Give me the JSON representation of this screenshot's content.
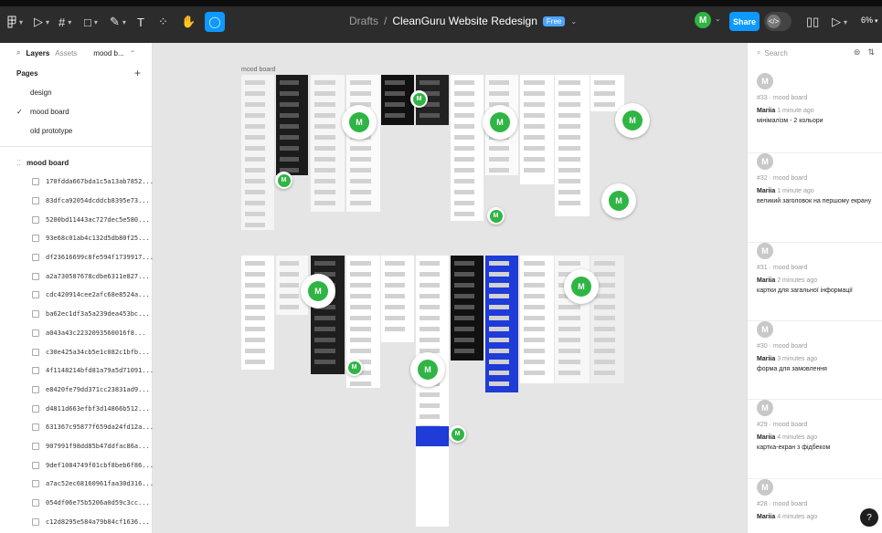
{
  "toolbar": {
    "breadcrumb_root": "Drafts",
    "separator": "/",
    "file_name": "CleanGuru Website Redesign",
    "plan_badge": "Free",
    "avatar_initial": "M",
    "share_label": "Share",
    "zoom_level": "6%"
  },
  "left_panel": {
    "tabs": {
      "layers": "Layers",
      "assets": "Assets",
      "page": "mood b..."
    },
    "pages_heading": "Pages",
    "pages": [
      {
        "label": "design",
        "selected": false
      },
      {
        "label": "mood board",
        "selected": true
      },
      {
        "label": "old prototype",
        "selected": false
      }
    ],
    "frame_name": "mood board",
    "layers": [
      "170fdda667bda1c5a13ab7852...",
      "83dfca92054dcddcb8395e73...",
      "5200bd11443ac727dec5e580...",
      "93e68c01ab4c132d5db80f25...",
      "df23616699c8fe594f1739917...",
      "a2a730587678cdbe6311e827...",
      "cdc420914cee2afc68e8524a...",
      "ba62ec1df3a5a239dea453bc...",
      "a043a43c2232093560016f8...",
      "c30e425a34cb5e1c082c1bfb...",
      "4f1148214bfd81a79a5d71091...",
      "e8420fe79dd371cc23831ad9...",
      "d4811d663efbf3d14866b512...",
      "631367c95877f659da24fd12a...",
      "907991f98dd85b47ddfac86a...",
      "9def1084749f01cbf8beb6f86...",
      "a7ac52ec68160961faa30d316...",
      "054df06e75b5206a0d59c3cc...",
      "c12d8295e584a79b84cf1636..."
    ]
  },
  "canvas": {
    "frame_label": "mood board",
    "pin_initial": "M"
  },
  "right_panel": {
    "search_placeholder": "Search",
    "comments": [
      {
        "avatar": "M",
        "meta": "#33 · mood board",
        "author": "Mariia",
        "time": "1 minute ago",
        "body": "мінімалізм - 2 кольори"
      },
      {
        "avatar": "M",
        "meta": "#32 · mood board",
        "author": "Mariia",
        "time": "1 minute ago",
        "body": "великий заголовок на першому екрану"
      },
      {
        "avatar": "M",
        "meta": "#31 · mood board",
        "author": "Mariia",
        "time": "2 minutes ago",
        "body": "картки для загальної інформації"
      },
      {
        "avatar": "M",
        "meta": "#30 · mood board",
        "author": "Mariia",
        "time": "3 minutes ago",
        "body": "форма для замовлення"
      },
      {
        "avatar": "M",
        "meta": "#29 · mood board",
        "author": "Mariia",
        "time": "4 minutes ago",
        "body": "картка-екран з фідбеком"
      },
      {
        "avatar": "M",
        "meta": "#28 · mood board",
        "author": "Mariia",
        "time": "4 minutes ago",
        "body": ""
      }
    ],
    "help_label": "?"
  },
  "colors": {
    "toolbar_bg": "#2c2c2c",
    "accent": "#0d99ff",
    "pin_green": "#2fb544",
    "canvas_bg": "#e5e5e5"
  }
}
